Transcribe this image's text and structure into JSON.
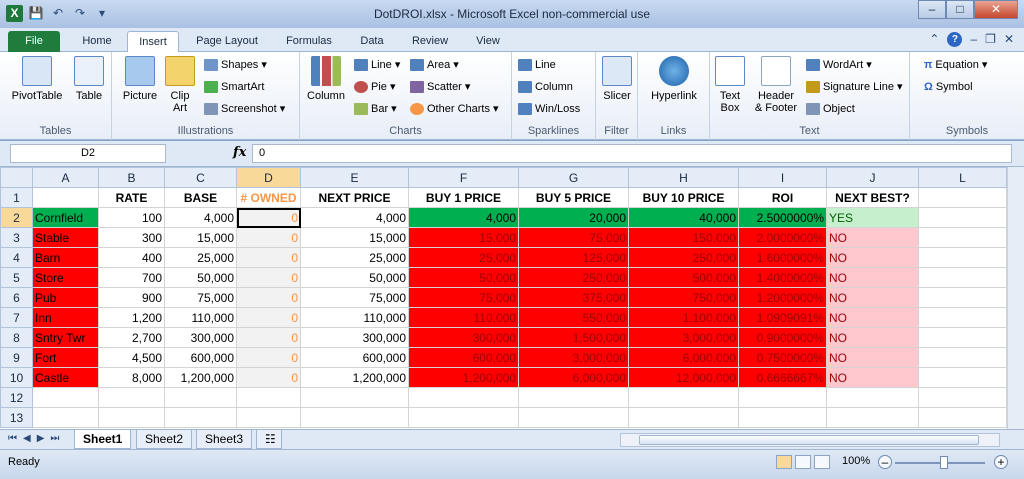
{
  "window": {
    "title": "DotDROI.xlsx  -  Microsoft Excel non-commercial use",
    "app_icon": "X"
  },
  "ribbon_tabs": [
    "File",
    "Home",
    "Insert",
    "Page Layout",
    "Formulas",
    "Data",
    "Review",
    "View"
  ],
  "ribbon": {
    "tables": {
      "label": "Tables",
      "pivot": "PivotTable",
      "table": "Table"
    },
    "illustrations": {
      "label": "Illustrations",
      "picture": "Picture",
      "clipart": "Clip\nArt",
      "shapes": "Shapes",
      "smartart": "SmartArt",
      "screenshot": "Screenshot"
    },
    "charts": {
      "label": "Charts",
      "column": "Column",
      "line": "Line",
      "pie": "Pie",
      "bar": "Bar",
      "area": "Area",
      "scatter": "Scatter",
      "other": "Other Charts"
    },
    "sparklines": {
      "label": "Sparklines",
      "line": "Line",
      "column": "Column",
      "winloss": "Win/Loss"
    },
    "filter": {
      "label": "Filter",
      "slicer": "Slicer"
    },
    "links": {
      "label": "Links",
      "hyperlink": "Hyperlink"
    },
    "text": {
      "label": "Text",
      "textbox": "Text\nBox",
      "header": "Header\n& Footer",
      "wordart": "WordArt",
      "signature": "Signature Line",
      "object": "Object"
    },
    "symbols": {
      "label": "Symbols",
      "equation": "Equation",
      "symbol": "Symbol"
    }
  },
  "formula_bar": {
    "name_box": "D2",
    "fx": "fx",
    "value": "0"
  },
  "columns": [
    "A",
    "B",
    "C",
    "D",
    "E",
    "F",
    "G",
    "H",
    "I",
    "J",
    "L"
  ],
  "header_row": [
    "",
    "RATE",
    "BASE",
    "# OWNED",
    "NEXT PRICE",
    "BUY 1 PRICE",
    "BUY 5 PRICE",
    "BUY 10 PRICE",
    "ROI",
    "NEXT BEST?",
    ""
  ],
  "rows": [
    [
      "Cornfield",
      "100",
      "4,000",
      "0",
      "4,000",
      "4,000",
      "20,000",
      "40,000",
      "2.5000000%",
      "YES"
    ],
    [
      "Stable",
      "300",
      "15,000",
      "0",
      "15,000",
      "15,000",
      "75,000",
      "150,000",
      "2.0000000%",
      "NO"
    ],
    [
      "Barn",
      "400",
      "25,000",
      "0",
      "25,000",
      "25,000",
      "125,000",
      "250,000",
      "1.6000000%",
      "NO"
    ],
    [
      "Store",
      "700",
      "50,000",
      "0",
      "50,000",
      "50,000",
      "250,000",
      "500,000",
      "1.4000000%",
      "NO"
    ],
    [
      "Pub",
      "900",
      "75,000",
      "0",
      "75,000",
      "75,000",
      "375,000",
      "750,000",
      "1.2000000%",
      "NO"
    ],
    [
      "Inn",
      "1,200",
      "110,000",
      "0",
      "110,000",
      "110,000",
      "550,000",
      "1,100,000",
      "1.0909091%",
      "NO"
    ],
    [
      "Sntry Twr",
      "2,700",
      "300,000",
      "0",
      "300,000",
      "300,000",
      "1,500,000",
      "3,000,000",
      "0.9000000%",
      "NO"
    ],
    [
      "Fort",
      "4,500",
      "600,000",
      "0",
      "600,000",
      "600,000",
      "3,000,000",
      "6,000,000",
      "0.7500000%",
      "NO"
    ],
    [
      "Castle",
      "8,000",
      "1,200,000",
      "0",
      "1,200,000",
      "1,200,000",
      "6,000,000",
      "12,000,000",
      "0.6666667%",
      "NO"
    ]
  ],
  "row_numbers": [
    "1",
    "2",
    "3",
    "4",
    "5",
    "6",
    "7",
    "8",
    "9",
    "10",
    "12",
    "13"
  ],
  "sheet_tabs": [
    "Sheet1",
    "Sheet2",
    "Sheet3"
  ],
  "status": {
    "ready": "Ready",
    "zoom": "100%"
  },
  "colors": {
    "excel_green": "#00b050",
    "red_fill": "#ff0000",
    "yes_fill": "#c6efce",
    "no_fill": "#ffc7ce"
  }
}
